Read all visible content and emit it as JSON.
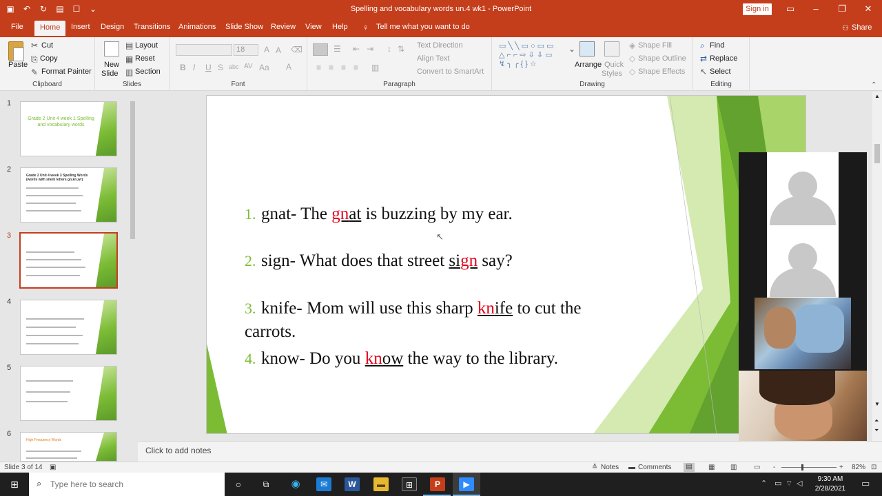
{
  "titlebar": {
    "document_title": "Spelling and vocabulary words un.4 wk1  -  PowerPoint",
    "signin": "Sign in",
    "qat_icons": [
      "save-icon",
      "undo-icon",
      "redo-icon",
      "present-icon",
      "touch-icon",
      "customize-icon"
    ]
  },
  "tabs": [
    "File",
    "Home",
    "Insert",
    "Design",
    "Transitions",
    "Animations",
    "Slide Show",
    "Review",
    "View",
    "Help"
  ],
  "tell_me": "Tell me what you want to do",
  "share": "Share",
  "ribbon": {
    "clipboard": {
      "paste": "Paste",
      "cut": "Cut",
      "copy": "Copy",
      "format_painter": "Format Painter",
      "label": "Clipboard"
    },
    "slides": {
      "new_slide_1": "New",
      "new_slide_2": "Slide",
      "layout": "Layout",
      "reset": "Reset",
      "section": "Section",
      "label": "Slides"
    },
    "font": {
      "size": "18",
      "label": "Font"
    },
    "paragraph": {
      "text_direction": "Text Direction",
      "align_text": "Align Text",
      "convert_smartart": "Convert to SmartArt",
      "label": "Paragraph"
    },
    "drawing": {
      "arrange": "Arrange",
      "quick_1": "Quick",
      "quick_2": "Styles",
      "shape_fill": "Shape Fill",
      "shape_outline": "Shape Outline",
      "shape_effects": "Shape Effects",
      "label": "Drawing"
    },
    "editing": {
      "find": "Find",
      "replace": "Replace",
      "select": "Select",
      "label": "Editing"
    }
  },
  "thumbnails": {
    "numbers": [
      "1",
      "2",
      "3",
      "4",
      "5",
      "6"
    ],
    "selected": "3",
    "slide1_title": "Grade 2 Unit 4 week 1 Spelling and vocabulary words",
    "slide2_title": "Grade 2 Unit 4 week 3 Spelling Words (words with silent letters gn,kn,wr)",
    "slide6_title": "High Frequency Words"
  },
  "slide": {
    "items": [
      {
        "num": "1.",
        "pre": "gnat- The ",
        "letters": "gn",
        "rest": "at",
        "post": " is buzzing by my ear."
      },
      {
        "num": "2.",
        "pre": "sign- What does that street ",
        "rest1": "si",
        "letters": "gn",
        "post": " say?"
      },
      {
        "num": "3.",
        "pre": "knife- Mom will use this sharp ",
        "letters": "kn",
        "rest": "ife",
        "post": " to cut the carrots."
      },
      {
        "num": "4.",
        "pre": "know- Do you ",
        "letters": "kn",
        "rest": "ow",
        "post": " the way to the library."
      }
    ]
  },
  "notes_placeholder": "Click to add notes",
  "statusbar": {
    "slide_info": "Slide 3 of 14",
    "notes": "Notes",
    "comments": "Comments",
    "zoom_minus": "-",
    "zoom_plus": "+",
    "zoom": "82%"
  },
  "taskbar": {
    "search_placeholder": "Type here to search",
    "time": "9:30 AM",
    "date": "2/28/2021"
  },
  "colors": {
    "accent": "#c43e1c",
    "slide_green": "#7cbc35",
    "highlight_red": "#e2001a"
  }
}
